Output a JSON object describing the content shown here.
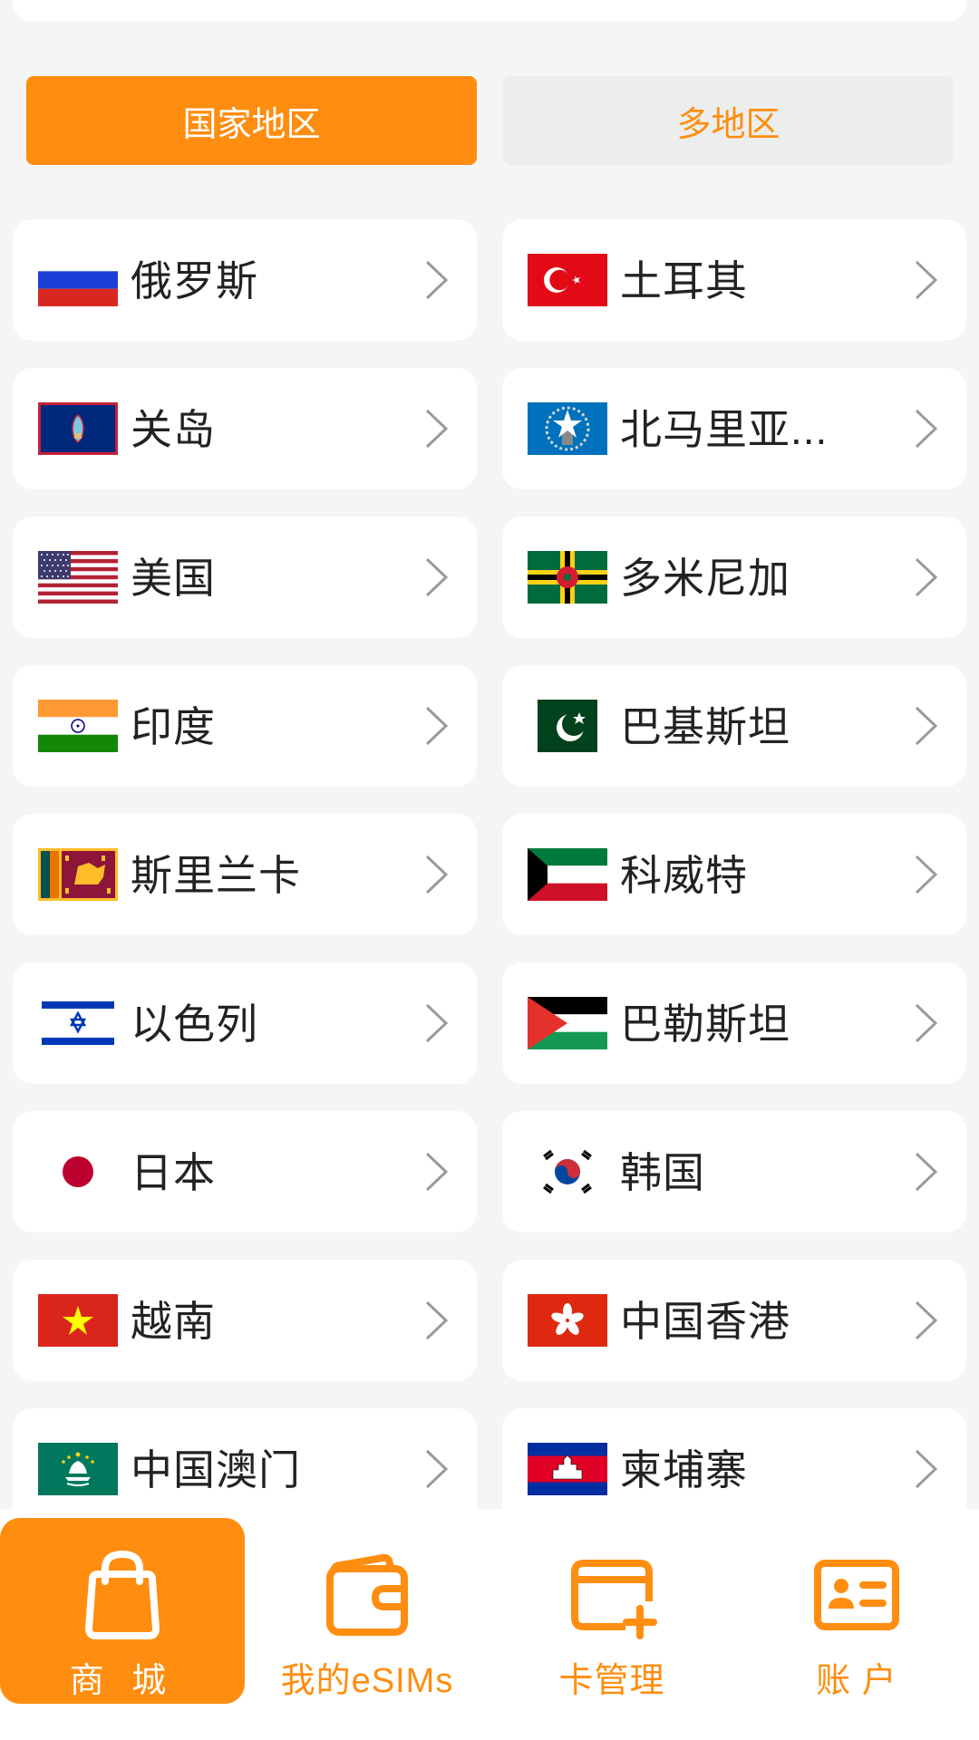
{
  "segments": {
    "active_label": "国家地区",
    "inactive_label": "多地区"
  },
  "countries": [
    "俄罗斯",
    "土耳其",
    "关岛",
    "北马里亚...",
    "美国",
    "多米尼加",
    "印度",
    "巴基斯坦",
    "斯里兰卡",
    "科威特",
    "以色列",
    "巴勒斯坦",
    "日本",
    "韩国",
    "越南",
    "中国香港",
    "中国澳门",
    "柬埔寨"
  ],
  "flag_icons": [
    "russia-flag",
    "turkey-flag",
    "guam-flag",
    "northern-mariana-islands-flag",
    "usa-flag",
    "dominica-flag",
    "india-flag",
    "pakistan-flag",
    "sri-lanka-flag",
    "kuwait-flag",
    "israel-flag",
    "palestine-flag",
    "japan-flag",
    "south-korea-flag",
    "vietnam-flag",
    "hong-kong-flag",
    "macau-flag",
    "cambodia-flag"
  ],
  "tabs": [
    {
      "label": "商 城",
      "icon": "shopping-bag-icon",
      "active": true
    },
    {
      "label": "我的eSIMs",
      "icon": "wallet-icon",
      "active": false
    },
    {
      "label": "卡管理",
      "icon": "card-add-icon",
      "active": false
    },
    {
      "label": "账 户",
      "icon": "id-card-icon",
      "active": false
    }
  ],
  "colors": {
    "accent": "#ff8d0f",
    "background": "#f5f5f5",
    "card": "#ffffff",
    "text": "#222222"
  }
}
